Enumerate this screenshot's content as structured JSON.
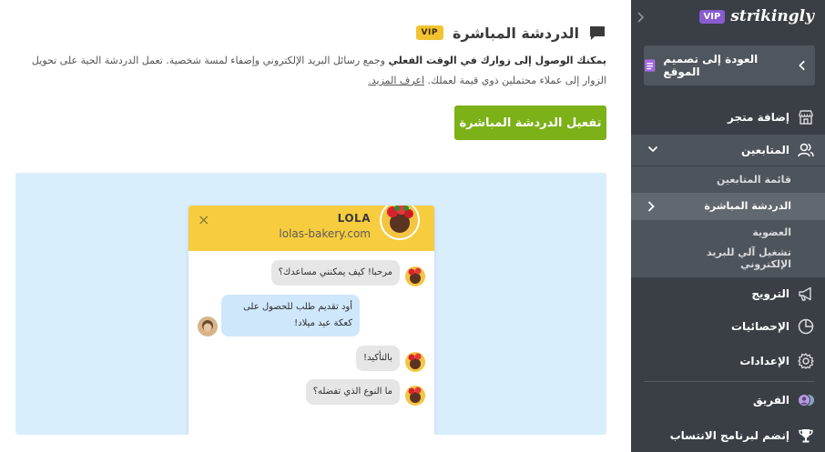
{
  "main": {
    "title": "الدردشة المباشرة",
    "vip_badge": "VIP",
    "description_bold": "يمكنك الوصول إلى زوارك في الوقت الفعلي",
    "description_rest": " وجمع رسائل البريد الإلكتروني وإضفاء لمسة شخصية. تعمل الدردشة الحية على تحويل الزوار إلى عملاء محتملين ذوي قيمة لعملك. ",
    "learn_more": "اعرف المزيد.",
    "cta_label": "تفعيل الدردشة المباشرة",
    "preview": {
      "widget_name": "LOLA",
      "widget_url": "lolas-bakery.com",
      "close_glyph": "×",
      "messages": [
        {
          "from": "agent",
          "text": "مرحبا! كيف يمكنني مساعدك؟"
        },
        {
          "from": "visitor",
          "text": "أود تقديم طلب للحصول على كعكة عيد ميلاد!"
        },
        {
          "from": "agent",
          "text": "بالتأكيد!"
        },
        {
          "from": "agent",
          "text": "ما النوع الذي تفضله؟"
        }
      ]
    }
  },
  "sidebar": {
    "vip_badge": "VIP",
    "logo": "strikingly",
    "back_label": "العودة إلى تصميم الموقع",
    "items": {
      "store": "إضافة متجر",
      "audience": "المتابعين",
      "promote": "الترويج",
      "stats": "الإحصائيات",
      "settings": "الإعدادات",
      "team": "الفريق",
      "affiliate": "إنضم لبرنامج الانتساب"
    },
    "sub_items": {
      "followers_list": "قائمة المتابعين",
      "live_chat": "الدردشة المباشرة",
      "membership": "العضوية",
      "email_autoresponder": "تشغيل آلي للبريد الإلكتروني"
    }
  },
  "colors": {
    "sidebar_bg": "#3a3f45",
    "sidebar_active": "#4e545b",
    "accent_green": "#7cb118",
    "vip_yellow": "#f2c230",
    "vip_purple": "#8a5cd0",
    "chat_header": "#f7cd3f",
    "preview_bg": "#d9eefd"
  },
  "icons": {
    "title": "chat-bubble-icon",
    "back": "chevron-left-icon",
    "store": "store-icon",
    "audience": "people-icon",
    "promote": "megaphone-icon",
    "stats": "pie-chart-icon",
    "settings": "gear-icon",
    "team": "team-avatar-icon",
    "affiliate": "trophy-icon"
  }
}
